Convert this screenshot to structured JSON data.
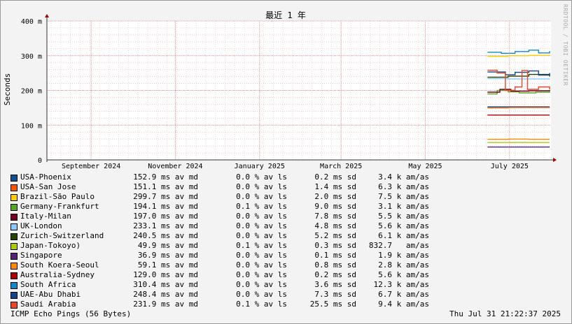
{
  "chart_data": {
    "type": "line",
    "title": "最近 1 年",
    "ylabel": "Seconds",
    "y_ticks": [
      {
        "value": 0,
        "label": "0"
      },
      {
        "value": 100,
        "label": "100 m"
      },
      {
        "value": 200,
        "label": "200 m"
      },
      {
        "value": 300,
        "label": "300 m"
      },
      {
        "value": 400,
        "label": "400 m"
      }
    ],
    "ylim": [
      0,
      400
    ],
    "x_ticks": [
      {
        "value": "2024-09-01",
        "label": "September 2024"
      },
      {
        "value": "2024-11-01",
        "label": "November 2024"
      },
      {
        "value": "2025-01-01",
        "label": "January 2025"
      },
      {
        "value": "2025-03-01",
        "label": "March 2025"
      },
      {
        "value": "2025-05-01",
        "label": "May 2025"
      },
      {
        "value": "2025-07-01",
        "label": "July 2025"
      }
    ],
    "xlim": [
      "2024-07-31",
      "2025-07-31"
    ],
    "grid": true,
    "series": [
      {
        "name": "USA-Phoenix",
        "color": "#10508a",
        "median": 152.9,
        "loss_pct": "0.0",
        "sd": "0.2",
        "am_as": "3.4 k",
        "points": [
          [
            "2025-06-15",
            153
          ],
          [
            "2025-06-30",
            153
          ],
          [
            "2025-07-15",
            153
          ],
          [
            "2025-07-30",
            153
          ]
        ]
      },
      {
        "name": "USA-San Jose",
        "color": "#ff5500",
        "median": 151.1,
        "loss_pct": "0.0",
        "sd": "1.4",
        "am_as": "6.3 k",
        "points": [
          [
            "2025-06-15",
            150
          ],
          [
            "2025-06-30",
            151
          ],
          [
            "2025-07-15",
            151
          ],
          [
            "2025-07-30",
            152
          ]
        ]
      },
      {
        "name": "Brazil-São Paulo",
        "color": "#ffcc00",
        "median": 299.7,
        "loss_pct": "0.0",
        "sd": "2.0",
        "am_as": "7.5 k",
        "points": [
          [
            "2025-06-15",
            298
          ],
          [
            "2025-06-30",
            300
          ],
          [
            "2025-07-15",
            301
          ],
          [
            "2025-07-30",
            299
          ]
        ]
      },
      {
        "name": "Germany-Frankfurt",
        "color": "#55aa22",
        "median": 194.1,
        "loss_pct": "0.1",
        "sd": "9.0",
        "am_as": "3.1 k",
        "points": [
          [
            "2025-06-15",
            190
          ],
          [
            "2025-06-22",
            200
          ],
          [
            "2025-06-30",
            196
          ],
          [
            "2025-07-08",
            193
          ],
          [
            "2025-07-20",
            195
          ],
          [
            "2025-07-30",
            197
          ]
        ]
      },
      {
        "name": "Italy-Milan",
        "color": "#770022",
        "median": 197.0,
        "loss_pct": "0.0",
        "sd": "7.8",
        "am_as": "5.5 k",
        "points": [
          [
            "2025-06-15",
            195
          ],
          [
            "2025-06-24",
            203
          ],
          [
            "2025-07-02",
            198
          ],
          [
            "2025-07-15",
            199
          ],
          [
            "2025-07-30",
            201
          ]
        ]
      },
      {
        "name": "UK-London",
        "color": "#88ccff",
        "median": 233.1,
        "loss_pct": "0.0",
        "sd": "4.8",
        "am_as": "5.6 k",
        "points": [
          [
            "2025-06-15",
            234
          ],
          [
            "2025-06-30",
            233
          ],
          [
            "2025-07-15",
            233
          ],
          [
            "2025-07-30",
            234
          ]
        ]
      },
      {
        "name": "Zurich-Switzerland",
        "color": "#224400",
        "median": 240.5,
        "loss_pct": "0.0",
        "sd": "5.2",
        "am_as": "6.1 k",
        "points": [
          [
            "2025-06-15",
            238
          ],
          [
            "2025-06-30",
            241
          ],
          [
            "2025-07-15",
            246
          ],
          [
            "2025-07-30",
            240
          ]
        ]
      },
      {
        "name": "Japan-Tokoyo)",
        "color": "#aacc00",
        "median": 49.9,
        "loss_pct": "0.1",
        "sd": "0.3",
        "am_as": "832.7  ",
        "points": [
          [
            "2025-06-15",
            50
          ],
          [
            "2025-07-30",
            50
          ]
        ]
      },
      {
        "name": "Singapore",
        "color": "#552277",
        "median": 36.9,
        "loss_pct": "0.0",
        "sd": "0.1",
        "am_as": "1.9 k",
        "points": [
          [
            "2025-06-15",
            37
          ],
          [
            "2025-07-30",
            37
          ]
        ]
      },
      {
        "name": "South Koera-Seoul",
        "color": "#ff8800",
        "median": 59.1,
        "loss_pct": "0.0",
        "sd": "0.8",
        "am_as": "2.8 k",
        "points": [
          [
            "2025-06-15",
            59
          ],
          [
            "2025-06-30",
            60
          ],
          [
            "2025-07-15",
            59
          ],
          [
            "2025-07-30",
            59
          ]
        ]
      },
      {
        "name": "Australia-Sydney",
        "color": "#aa0000",
        "median": 129.0,
        "loss_pct": "0.0",
        "sd": "0.2",
        "am_as": "5.6 k",
        "points": [
          [
            "2025-06-15",
            129
          ],
          [
            "2025-07-30",
            129
          ]
        ]
      },
      {
        "name": "South Africa",
        "color": "#1188cc",
        "median": 310.4,
        "loss_pct": "0.0",
        "sd": "3.6",
        "am_as": "12.3 k",
        "points": [
          [
            "2025-06-15",
            310
          ],
          [
            "2025-06-25",
            307
          ],
          [
            "2025-07-05",
            312
          ],
          [
            "2025-07-15",
            316
          ],
          [
            "2025-07-22",
            308
          ],
          [
            "2025-07-30",
            313
          ]
        ]
      },
      {
        "name": "UAE-Abu Dhabi",
        "color": "#114488",
        "median": 248.4,
        "loss_pct": "0.0",
        "sd": "7.3",
        "am_as": "6.7 k",
        "points": [
          [
            "2025-06-15",
            253
          ],
          [
            "2025-06-28",
            245
          ],
          [
            "2025-07-05",
            252
          ],
          [
            "2025-07-15",
            256
          ],
          [
            "2025-07-22",
            244
          ],
          [
            "2025-07-30",
            250
          ]
        ]
      },
      {
        "name": "Saudi Arabia",
        "color": "#ee4422",
        "median": 231.9,
        "loss_pct": "0.1",
        "sd": "25.5",
        "am_as": "9.4 k",
        "points": [
          [
            "2025-06-15",
            258
          ],
          [
            "2025-06-22",
            250
          ],
          [
            "2025-06-28",
            200
          ],
          [
            "2025-07-05",
            210
          ],
          [
            "2025-07-10",
            257
          ],
          [
            "2025-07-14",
            203
          ],
          [
            "2025-07-22",
            210
          ],
          [
            "2025-07-30",
            203
          ]
        ]
      }
    ]
  },
  "legend": {
    "avg_unit": "ms av md",
    "loss_unit": "% av ls",
    "sd_unit": "ms sd",
    "amas_unit": "am/as"
  },
  "footer": {
    "left": "ICMP Echo Pings (56 Bytes)",
    "right": "Thu Jul 31 21:22:37 2025"
  },
  "watermark": "RRDTOOL / TOBI OETIKER"
}
